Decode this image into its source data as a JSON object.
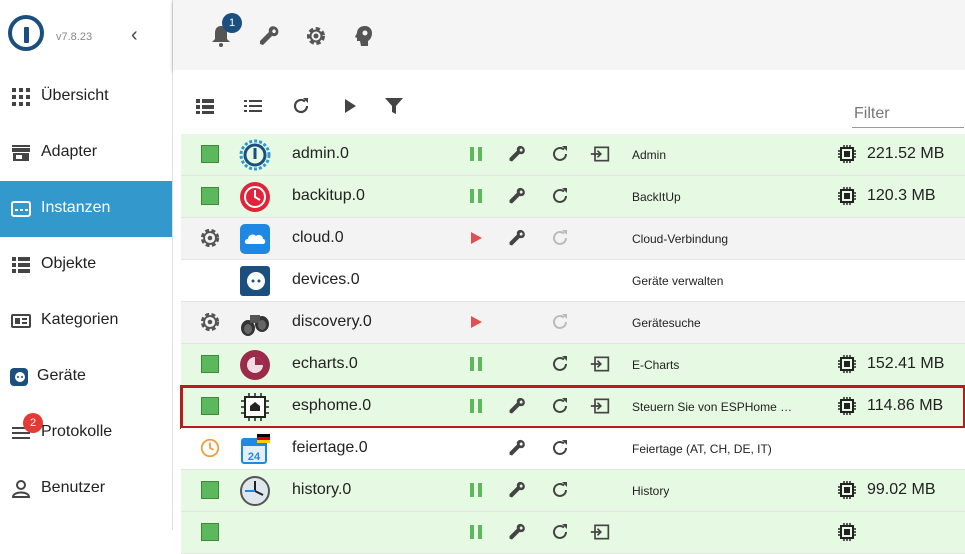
{
  "sidebar": {
    "version": "v7.8.23",
    "items": [
      {
        "label": "Übersicht"
      },
      {
        "label": "Adapter"
      },
      {
        "label": "Instanzen"
      },
      {
        "label": "Objekte"
      },
      {
        "label": "Kategorien"
      },
      {
        "label": "Geräte"
      },
      {
        "label": "Protokolle",
        "badge": "2"
      },
      {
        "label": "Benutzer"
      }
    ]
  },
  "topbar": {
    "notification_count": "1",
    "icons": [
      "bell-icon",
      "wrench-icon",
      "gear-icon",
      "expert-head-icon"
    ]
  },
  "toolbar": {
    "filter_placeholder": "Filter",
    "icons": [
      "table-view-icon",
      "list-view-icon",
      "refresh-icon",
      "play-icon",
      "filter-icon"
    ]
  },
  "instances": [
    {
      "name": "admin.0",
      "title": "Admin",
      "memory": "221.52 MB",
      "status": "running"
    },
    {
      "name": "backitup.0",
      "title": "BackItUp",
      "memory": "120.3 MB",
      "status": "running"
    },
    {
      "name": "cloud.0",
      "title": "Cloud-Verbindung",
      "memory": "",
      "status": "stopped"
    },
    {
      "name": "devices.0",
      "title": "Geräte verwalten",
      "memory": "",
      "status": "none"
    },
    {
      "name": "discovery.0",
      "title": "Gerätesuche",
      "memory": "",
      "status": "stopped"
    },
    {
      "name": "echarts.0",
      "title": "E-Charts",
      "memory": "152.41 MB",
      "status": "running"
    },
    {
      "name": "esphome.0",
      "title": "Steuern Sie von ESPHome …",
      "memory": "114.86 MB",
      "status": "running"
    },
    {
      "name": "feiertage.0",
      "title": "Feiertage (AT, CH, DE, IT)",
      "memory": "",
      "status": "scheduled"
    },
    {
      "name": "history.0",
      "title": "History",
      "memory": "99.02 MB",
      "status": "running"
    }
  ],
  "colors": {
    "accent": "#3399cc",
    "running_row": "#e6f9e2",
    "stopped_row": "#f3f3f3",
    "pause_green": "#5cb85c",
    "play_red": "#e05050",
    "highlight": "#b71c1c"
  }
}
